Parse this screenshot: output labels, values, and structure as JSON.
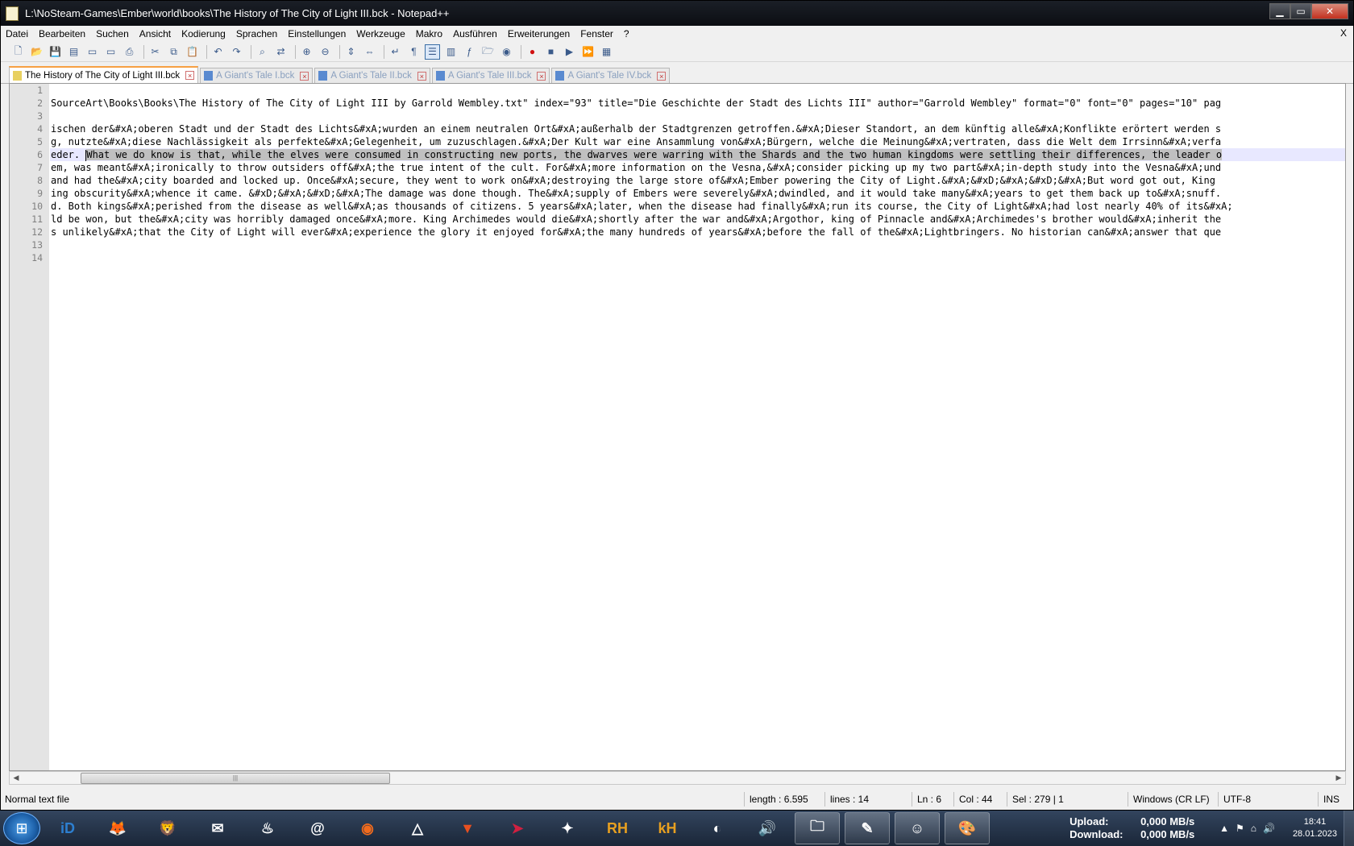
{
  "window": {
    "title": "L:\\NoSteam-Games\\Ember\\world\\books\\The History of The City of Light III.bck - Notepad++",
    "min": "▁",
    "max": "▭",
    "close": "✕"
  },
  "menu": [
    "Datei",
    "Bearbeiten",
    "Suchen",
    "Ansicht",
    "Kodierung",
    "Sprachen",
    "Einstellungen",
    "Werkzeuge",
    "Makro",
    "Ausführen",
    "Erweiterungen",
    "Fenster",
    "?"
  ],
  "menu_close": "X",
  "toolbar_icons": [
    "new-file-icon",
    "open-file-icon",
    "save-icon",
    "save-all-icon",
    "close-icon",
    "close-all-icon",
    "print-icon",
    "sep",
    "cut-icon",
    "copy-icon",
    "paste-icon",
    "sep",
    "undo-icon",
    "redo-icon",
    "sep",
    "find-icon",
    "replace-icon",
    "sep",
    "zoom-in-icon",
    "zoom-out-icon",
    "sep",
    "sync-vertical-icon",
    "sync-horizontal-icon",
    "sep",
    "word-wrap-icon",
    "show-all-chars-icon",
    "indent-guide-icon",
    "doc-map-icon",
    "function-list-icon",
    "folder-workspace-icon",
    "monitoring-icon",
    "sep",
    "record-macro-icon",
    "stop-macro-icon",
    "play-macro-icon",
    "run-macro-multiple-icon",
    "save-macro-icon"
  ],
  "tabs": [
    {
      "label": "The History of The City of Light III.bck",
      "active": true
    },
    {
      "label": "A Giant's Tale I.bck",
      "active": false
    },
    {
      "label": "A Giant's Tale II.bck",
      "active": false
    },
    {
      "label": "A Giant's Tale III.bck",
      "active": false
    },
    {
      "label": "A Giant's Tale IV.bck",
      "active": false
    }
  ],
  "editor": {
    "line_numbers": [
      "1",
      "2",
      "3",
      "4",
      "5",
      "6",
      "7",
      "8",
      "9",
      "10",
      "11",
      "12",
      "13",
      "14"
    ],
    "lines": [
      "",
      "SourceArt\\Books\\Books\\The History of The City of Light III by Garrold Wembley.txt\" index=\"93\" title=\"Die Geschichte der Stadt des Lichts III\" author=\"Garrold Wembley\" format=\"0\" font=\"0\" pages=\"10\" pag",
      "",
      "ischen der&#xA;oberen Stadt und der Stadt des Lichts&#xA;wurden an einem neutralen Ort&#xA;außerhalb der Stadtgrenzen getroffen.&#xA;Dieser Standort, an dem künftig alle&#xA;Konflikte erörtert werden s",
      "g, nutzte&#xA;diese Nachlässigkeit als perfekte&#xA;Gelegenheit, um zuzuschlagen.&#xA;Der Kult war eine Ansammlung von&#xA;Bürgern, welche die Meinung&#xA;vertraten, dass die Welt dem Irrsinn&#xA;verfa",
      "",
      "em, was meant&#xA;ironically to throw outsiders off&#xA;the true intent of the cult. For&#xA;more information on the Vesna,&#xA;consider picking up my two part&#xA;in-depth study into the Vesna&#xA;und",
      "and had the&#xA;city boarded and locked up. Once&#xA;secure, they went to work on&#xA;destroying the large store of&#xA;Ember powering the City of Light.&#xA;&#xD;&#xA;&#xD;&#xA;But word got out, King",
      "ing obscurity&#xA;whence it came. &#xD;&#xA;&#xD;&#xA;The damage was done though. The&#xA;supply of Embers were severely&#xA;dwindled, and it would take many&#xA;years to get them back up to&#xA;snuff.",
      "d. Both kings&#xA;perished from the disease as well&#xA;as thousands of citizens. 5 years&#xA;later, when the disease had finally&#xA;run its course, the City of Light&#xA;had lost nearly 40% of its&#xA;",
      "ld be won, but the&#xA;city was horribly damaged once&#xA;more. King Archimedes would die&#xA;shortly after the war and&#xA;Argothor, king of Pinnacle and&#xA;Archimedes's brother would&#xA;inherit the",
      "s unlikely&#xA;that the City of Light will ever&#xA;experience the glory it enjoyed for&#xA;the many hundreds of years&#xA;before the fall of the&#xA;Lightbringers. No historian can&#xA;answer that que",
      "",
      ""
    ],
    "line6_prefix": "eder. ",
    "line6_selected": "What we do know is that, while the elves were consumed in constructing new ports, the dwarves were warring with the Shards and the two human kingdoms were settling their differences, the leader o"
  },
  "hscroll": {
    "left": "◀",
    "right": "▶",
    "grip": "|||"
  },
  "status": {
    "type": "Normal text file",
    "length": "length : 6.595",
    "lines": "lines : 14",
    "ln": "Ln : 6",
    "col": "Col : 44",
    "sel": "Sel : 279 | 1",
    "eol": "Windows (CR LF)",
    "enc": "UTF-8",
    "mode": "INS"
  },
  "taskbar": {
    "start": "⊞",
    "apps": [
      {
        "name": "idm-app",
        "label": "iD"
      },
      {
        "name": "firefox-app",
        "label": "🦊"
      },
      {
        "name": "brave-app",
        "label": "🦁"
      },
      {
        "name": "thunderbird-app",
        "label": "✉"
      },
      {
        "name": "steam-app",
        "label": "♨"
      },
      {
        "name": "browser-app",
        "label": "@"
      },
      {
        "name": "origin-app",
        "label": "◉"
      },
      {
        "name": "epic-app",
        "label": "△"
      },
      {
        "name": "flag-app",
        "label": "▼"
      },
      {
        "name": "arrow-app",
        "label": "➤"
      },
      {
        "name": "sword-app",
        "label": "✦"
      },
      {
        "name": "rh-app",
        "label": "RH"
      },
      {
        "name": "kh-app",
        "label": "kH"
      },
      {
        "name": "gradient-app",
        "label": "◐"
      },
      {
        "name": "speaker-app",
        "label": "🔊"
      },
      {
        "name": "explorer-app",
        "label": "🗀"
      },
      {
        "name": "notepadpp-app",
        "label": "✎"
      },
      {
        "name": "game-app",
        "label": "☺"
      },
      {
        "name": "paint-app",
        "label": "🎨"
      }
    ],
    "upload_label": "Upload:",
    "upload_value": "0,000 MB/s",
    "download_label": "Download:",
    "download_value": "0,000 MB/s",
    "tray_icons": [
      "▲",
      "⚑",
      "⌂",
      "🔊"
    ],
    "time": "18:41",
    "date": "28.01.2023"
  }
}
